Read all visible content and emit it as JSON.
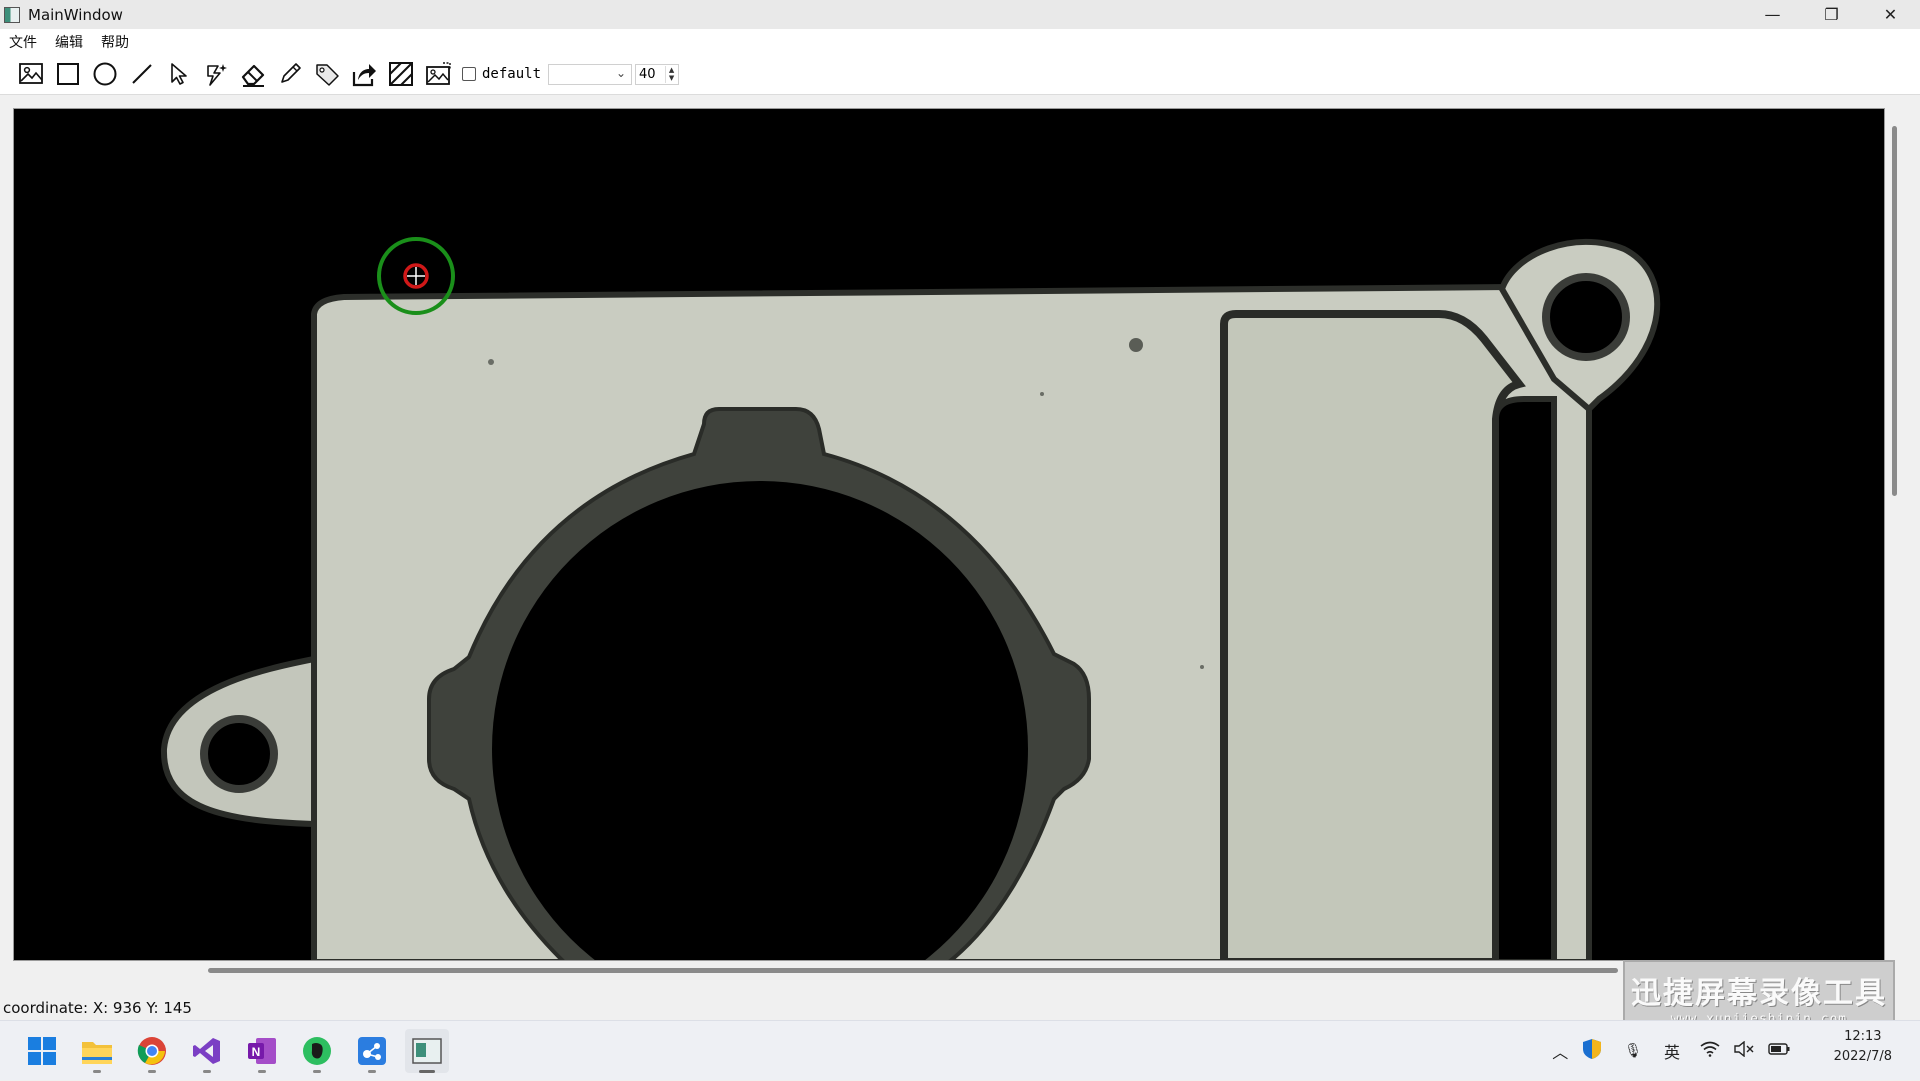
{
  "window": {
    "title": "MainWindow"
  },
  "window_controls": {
    "minimize": "—",
    "restore": "❐",
    "close": "✕"
  },
  "menu": {
    "file": "文件",
    "edit": "编辑",
    "help": "帮助"
  },
  "toolbar": {
    "checkbox_label": "default",
    "select_value": "",
    "spin_value": "40",
    "icons": [
      "image-icon",
      "rectangle-icon",
      "circle-icon",
      "line-icon",
      "pointer-icon",
      "magic-wand-icon",
      "eraser-icon",
      "pencil-icon",
      "tag-icon",
      "export-icon",
      "mask-icon",
      "screenshot-icon"
    ]
  },
  "status": {
    "coordinate": "coordinate: X: 936 Y: 145"
  },
  "watermark": {
    "title": "迅捷屏幕录像工具",
    "url": "www.xunjieshipin.com"
  },
  "tray": {
    "ime": "英",
    "time": "12:13",
    "date": "2022/7/8"
  },
  "taskbar": {
    "apps": [
      "windows-start-icon",
      "file-explorer-icon",
      "chrome-icon",
      "visual-studio-icon",
      "onenote-icon",
      "evernote-icon",
      "app-blue-icon",
      "mainwindow-app-icon"
    ]
  },
  "colors": {
    "canvas": "#000000",
    "part": "#c9cdc0",
    "annotation_outer": "#1a8f1a",
    "annotation_inner": "#d01818"
  }
}
